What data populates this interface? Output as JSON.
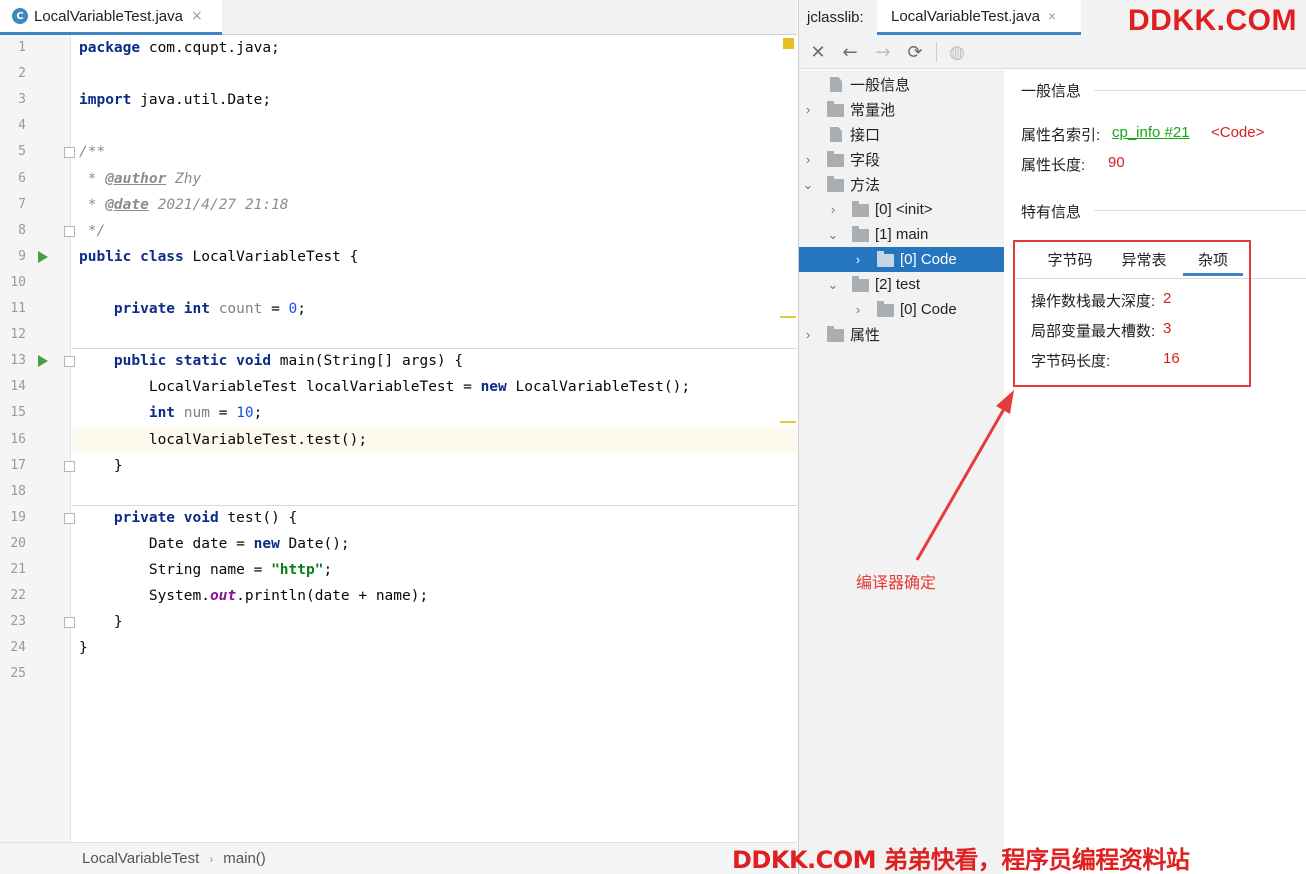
{
  "editor": {
    "tab_title": "LocalVariableTest.java",
    "tab_close": "×",
    "java_icon_letter": "C",
    "lines": [
      {
        "n": "1",
        "spans": [
          {
            "c": "kw",
            "t": "package"
          },
          {
            "c": "",
            "t": " com.cqupt.java;"
          }
        ]
      },
      {
        "n": "2",
        "spans": []
      },
      {
        "n": "3",
        "spans": [
          {
            "c": "kw",
            "t": "import"
          },
          {
            "c": "",
            "t": " java.util.Date;"
          }
        ]
      },
      {
        "n": "4",
        "spans": []
      },
      {
        "n": "5",
        "spans": [
          {
            "c": "cm",
            "t": "/**"
          }
        ]
      },
      {
        "n": "6",
        "spans": [
          {
            "c": "cm",
            "t": " * "
          },
          {
            "c": "tag",
            "t": "@author"
          },
          {
            "c": "cm",
            "t": " Zhy"
          }
        ]
      },
      {
        "n": "7",
        "spans": [
          {
            "c": "cm",
            "t": " * "
          },
          {
            "c": "tag",
            "t": "@date"
          },
          {
            "c": "cm",
            "t": " 2021/4/27 21:18"
          }
        ]
      },
      {
        "n": "8",
        "spans": [
          {
            "c": "cm",
            "t": " */"
          }
        ]
      },
      {
        "n": "9",
        "spans": [
          {
            "c": "kw",
            "t": "public class"
          },
          {
            "c": "",
            "t": " LocalVariableTest {"
          }
        ]
      },
      {
        "n": "10",
        "spans": []
      },
      {
        "n": "11",
        "spans": [
          {
            "c": "",
            "t": "    "
          },
          {
            "c": "kw",
            "t": "private int"
          },
          {
            "c": "",
            "t": " "
          },
          {
            "c": "unused",
            "t": "count"
          },
          {
            "c": "",
            "t": " = "
          },
          {
            "c": "num",
            "t": "0"
          },
          {
            "c": "",
            "t": ";"
          }
        ]
      },
      {
        "n": "12",
        "spans": []
      },
      {
        "n": "13",
        "spans": [
          {
            "c": "",
            "t": "    "
          },
          {
            "c": "kw",
            "t": "public static void"
          },
          {
            "c": "",
            "t": " main(String[] args) {"
          }
        ]
      },
      {
        "n": "14",
        "spans": [
          {
            "c": "",
            "t": "        LocalVariableTest localVariableTest = "
          },
          {
            "c": "kw",
            "t": "new"
          },
          {
            "c": "",
            "t": " LocalVariableTest();"
          }
        ]
      },
      {
        "n": "15",
        "spans": [
          {
            "c": "",
            "t": "        "
          },
          {
            "c": "kw",
            "t": "int"
          },
          {
            "c": "",
            "t": " "
          },
          {
            "c": "unused",
            "t": "num"
          },
          {
            "c": "",
            "t": " = "
          },
          {
            "c": "num",
            "t": "10"
          },
          {
            "c": "",
            "t": ";"
          }
        ]
      },
      {
        "n": "16",
        "spans": [
          {
            "c": "",
            "t": "        localVariableTest.test();"
          }
        ]
      },
      {
        "n": "17",
        "spans": [
          {
            "c": "",
            "t": "    }"
          }
        ]
      },
      {
        "n": "18",
        "spans": []
      },
      {
        "n": "19",
        "spans": [
          {
            "c": "",
            "t": "    "
          },
          {
            "c": "kw",
            "t": "private void"
          },
          {
            "c": "",
            "t": " test() {"
          }
        ]
      },
      {
        "n": "20",
        "spans": [
          {
            "c": "",
            "t": "        Date date = "
          },
          {
            "c": "kw",
            "t": "new"
          },
          {
            "c": "",
            "t": " Date();"
          }
        ]
      },
      {
        "n": "21",
        "spans": [
          {
            "c": "",
            "t": "        String name = "
          },
          {
            "c": "str",
            "t": "\"http\""
          },
          {
            "c": "",
            "t": ";"
          }
        ]
      },
      {
        "n": "22",
        "spans": [
          {
            "c": "",
            "t": "        System."
          },
          {
            "c": "fld",
            "t": "out"
          },
          {
            "c": "",
            "t": ".println(date + name);"
          }
        ]
      },
      {
        "n": "23",
        "spans": [
          {
            "c": "",
            "t": "    }"
          }
        ]
      },
      {
        "n": "24",
        "spans": [
          {
            "c": "",
            "t": "}"
          }
        ]
      },
      {
        "n": "25",
        "spans": []
      }
    ],
    "current_line": "16",
    "breadcrumb": [
      "LocalVariableTest",
      "main()"
    ],
    "breadcrumb_sep": "›"
  },
  "jclasslib": {
    "label": "jclasslib:",
    "tab_title": "LocalVariableTest.java",
    "tab_close": "×",
    "toolbar": [
      {
        "name": "close-icon",
        "glyph": "✕",
        "enabled": true
      },
      {
        "name": "back-arrow-icon",
        "glyph": "←",
        "enabled": true
      },
      {
        "name": "forward-arrow-icon",
        "glyph": "→",
        "enabled": false
      },
      {
        "name": "refresh-icon",
        "glyph": "⟳",
        "enabled": true
      },
      {
        "name": "globe-icon",
        "glyph": "◍",
        "enabled": false
      }
    ],
    "tree": [
      {
        "label": "一般信息",
        "level": 0,
        "chevron": "",
        "icon": "file"
      },
      {
        "label": "常量池",
        "level": 0,
        "chevron": "›",
        "icon": "folder"
      },
      {
        "label": "接口",
        "level": 0,
        "chevron": "",
        "icon": "file"
      },
      {
        "label": "字段",
        "level": 0,
        "chevron": "›",
        "icon": "folder"
      },
      {
        "label": "方法",
        "level": 0,
        "chevron": "⌄",
        "icon": "folder"
      },
      {
        "label": "[0] <init>",
        "level": 1,
        "chevron": "›",
        "icon": "folder"
      },
      {
        "label": "[1] main",
        "level": 1,
        "chevron": "⌄",
        "icon": "folder"
      },
      {
        "label": "[0] Code",
        "level": 2,
        "chevron": "›",
        "icon": "folder",
        "selected": true
      },
      {
        "label": "[2] test",
        "level": 1,
        "chevron": "⌄",
        "icon": "folder"
      },
      {
        "label": "[0] Code",
        "level": 2,
        "chevron": "›",
        "icon": "folder"
      },
      {
        "label": "属性",
        "level": 0,
        "chevron": "›",
        "icon": "folder"
      }
    ],
    "general": {
      "title": "一般信息",
      "name_index_label": "属性名索引:",
      "name_index_link": "cp_info #21",
      "name_index_tag": "<Code>",
      "length_label": "属性长度:",
      "length_value": "90"
    },
    "specific": {
      "title": "特有信息",
      "tabs": [
        "字节码",
        "异常表",
        "杂项"
      ],
      "active_tab": "杂项",
      "rows": [
        {
          "label": "操作数栈最大深度:",
          "value": "2"
        },
        {
          "label": "局部变量最大槽数:",
          "value": "3"
        },
        {
          "label": "字节码长度:",
          "value": "16"
        }
      ]
    }
  },
  "annotation": {
    "text": "编译器确定",
    "color": "#e53b3b"
  },
  "watermark": {
    "top": "DDKK.COM",
    "bottom": "DDKK.COM 弟弟快看，程序员编程资料站",
    "color": "#e02020"
  }
}
